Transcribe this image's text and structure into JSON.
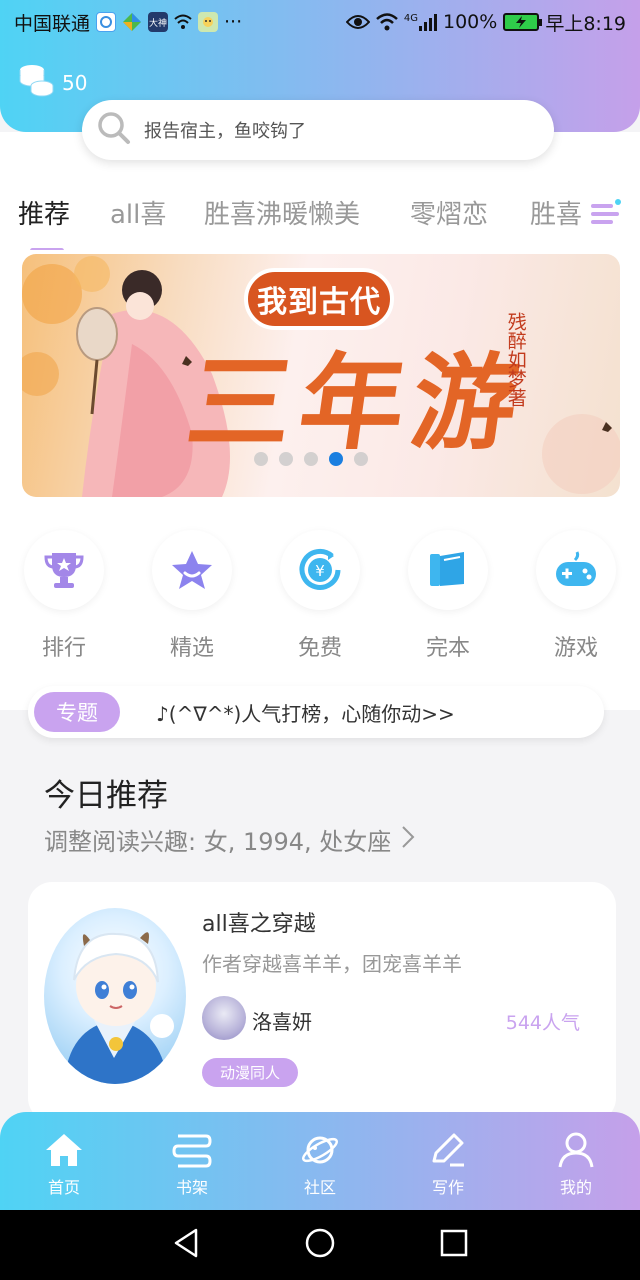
{
  "status_bar": {
    "carrier": "中国联通",
    "network": "4G",
    "battery": "100%",
    "time": "早上8:19"
  },
  "header": {
    "coin_count": "50",
    "search_placeholder": "报告宿主，鱼咬钩了"
  },
  "tabs": [
    {
      "label": "推荐"
    },
    {
      "label": "all喜"
    },
    {
      "label": "胜喜沸暖懒美"
    },
    {
      "label": "零熠恋"
    },
    {
      "label": "胜喜"
    }
  ],
  "banner": {
    "title": "我到古代",
    "big_text": "三年游",
    "author": "残醉如梦著",
    "dot_count": 5,
    "active_dot": 3
  },
  "quick_links": [
    {
      "label": "排行",
      "icon": "trophy-icon"
    },
    {
      "label": "精选",
      "icon": "star-icon"
    },
    {
      "label": "免费",
      "icon": "yuan-icon"
    },
    {
      "label": "完本",
      "icon": "book-icon"
    },
    {
      "label": "游戏",
      "icon": "gamepad-icon"
    }
  ],
  "topic": {
    "badge": "专题",
    "text": "♪(^∇^*)人气打榜，心随你动>>"
  },
  "today": {
    "title": "今日推荐",
    "subtitle": "调整阅读兴趣: 女, 1994, 处女座"
  },
  "book": {
    "title": "all喜之穿越",
    "description": "作者穿越喜羊羊，团宠喜羊羊",
    "author": "洛喜妍",
    "popularity": "544人气",
    "tag": "动漫同人"
  },
  "bottom_nav": [
    {
      "label": "首页",
      "icon": "home-icon"
    },
    {
      "label": "书架",
      "icon": "bookshelf-icon"
    },
    {
      "label": "社区",
      "icon": "planet-icon"
    },
    {
      "label": "写作",
      "icon": "pen-icon"
    },
    {
      "label": "我的",
      "icon": "profile-icon"
    }
  ],
  "colors": {
    "accent_purple": "#c9a3ef",
    "gradient_start": "#4fd3f4",
    "gradient_end": "#c5a0ea",
    "dot_active": "#1b7fe0"
  }
}
